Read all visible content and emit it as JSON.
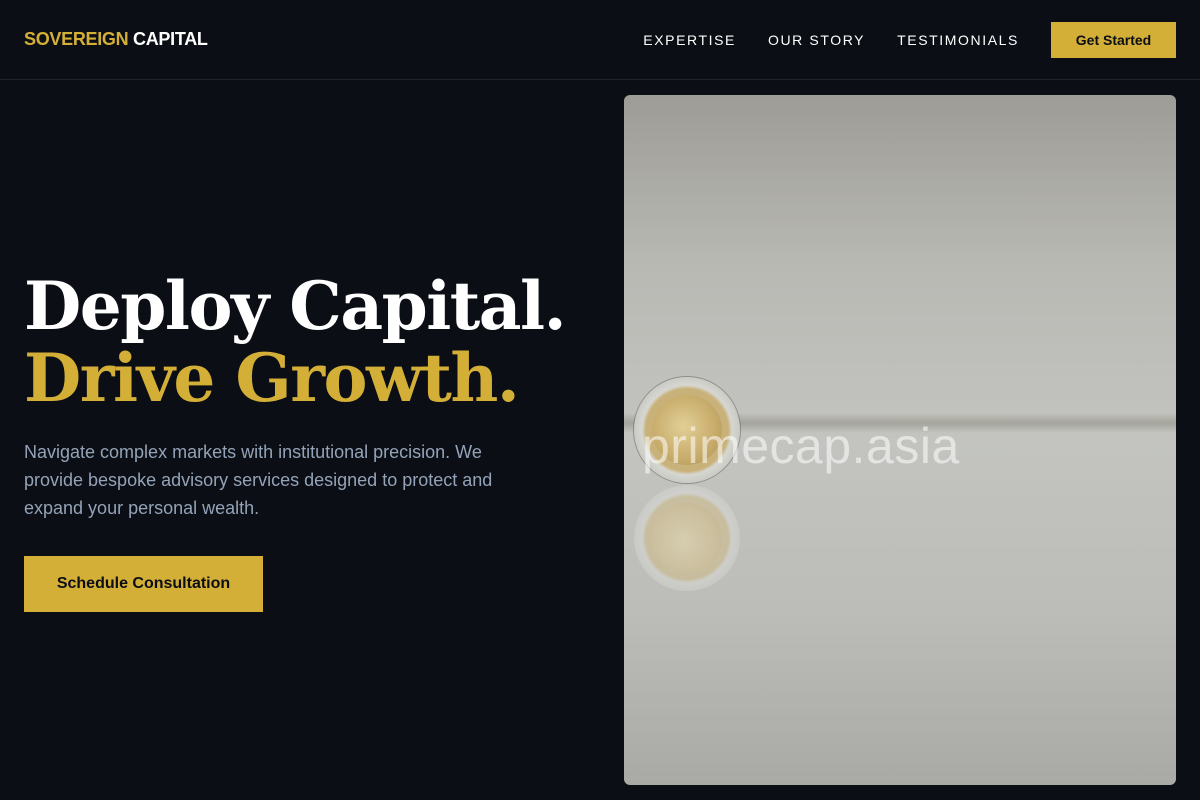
{
  "header": {
    "logo_part1": "SOVEREIGN",
    "logo_part2": "CAPITAL",
    "nav": [
      {
        "label": "EXPERTISE"
      },
      {
        "label": "OUR STORY"
      },
      {
        "label": "TESTIMONIALS"
      }
    ],
    "cta_label": "Get Started"
  },
  "hero": {
    "headline_line1": "Deploy Capital.",
    "headline_line2": "Drive Growth.",
    "description": "Navigate complex markets with institutional precision. We provide bespoke advisory services designed to protect and expand your personal wealth.",
    "cta_label": "Schedule Consultation",
    "image_watermark": "primecap.asia"
  },
  "colors": {
    "background": "#0b0e14",
    "accent": "#d4af37",
    "text_primary": "#ffffff",
    "text_muted": "#94a3b8"
  }
}
